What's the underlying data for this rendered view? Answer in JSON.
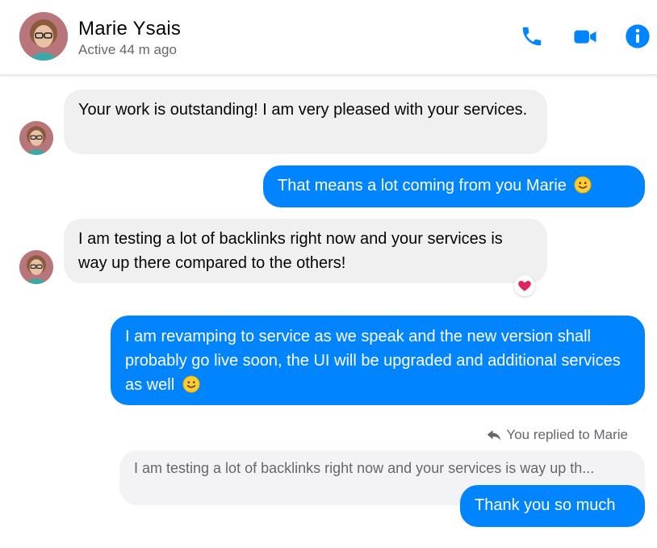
{
  "header": {
    "name": "Marie Ysais",
    "status": "Active 44 m ago",
    "icons": [
      "phone-icon",
      "video-camera-icon",
      "info-icon"
    ]
  },
  "messages": [
    {
      "direction": "incoming",
      "text": "Your work is outstanding! I am very pleased with your services."
    },
    {
      "direction": "outgoing",
      "text": "That means a lot coming from you Marie",
      "emoji": "slightly-smiling-face"
    },
    {
      "direction": "incoming",
      "text": "I am testing a lot of backlinks right now and your services is way up there compared to the others!",
      "reaction": "red-heart"
    },
    {
      "direction": "outgoing",
      "text": "I am revamping to service as we speak and the new version shall probably go live soon, the UI will be upgraded and additional services as well",
      "emoji": "slightly-smiling-face"
    },
    {
      "direction": "outgoing",
      "text": "Thank you so much"
    }
  ],
  "reply": {
    "label": "You replied to Marie",
    "quoted_text": "I am testing a lot of backlinks right now and your services is way up th..."
  },
  "colors": {
    "accent": "#0084ff",
    "incoming_bubble": "#f0f0f0",
    "secondary_text": "#65676b",
    "heart": "#e0245e"
  }
}
